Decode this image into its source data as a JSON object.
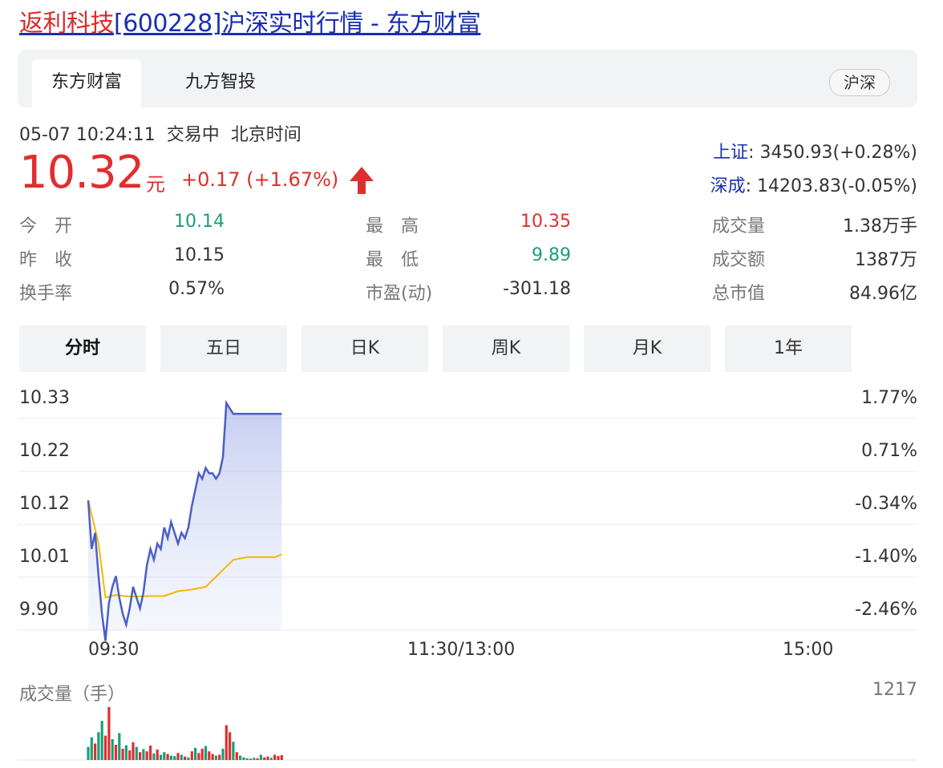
{
  "page_title": {
    "stock_name": "返利科技",
    "code": "[600228]",
    "suffix": "沪深实时行情 - 东方财富"
  },
  "tabs": [
    {
      "label": "东方财富",
      "active": true
    },
    {
      "label": "九方智投",
      "active": false
    }
  ],
  "market_pill": "沪深",
  "status": {
    "datetime": "05-07 10:24:11",
    "state": "交易中",
    "tz": "北京时间"
  },
  "quote": {
    "price": "10.32",
    "currency": "元",
    "change": "+0.17 (+1.67%)"
  },
  "indices": [
    {
      "name": "上证",
      "value": ": 3450.93(+0.28%)"
    },
    {
      "name": "深成",
      "value": ": 14203.83(-0.05%)"
    }
  ],
  "stats": [
    {
      "label": "今　开",
      "value": "10.14",
      "color": "green"
    },
    {
      "label": "昨　收",
      "value": "10.15",
      "color": "normal"
    },
    {
      "label": "换手率",
      "value": "0.57%",
      "color": "normal"
    },
    {
      "label": "最　高",
      "value": "10.35",
      "color": "red"
    },
    {
      "label": "最　低",
      "value": "9.89",
      "color": "green"
    },
    {
      "label": "市盈(动)",
      "value": "-301.18",
      "color": "normal"
    },
    {
      "label": "成交量",
      "value": "1.38万手",
      "color": "normal"
    },
    {
      "label": "成交额",
      "value": "1387万",
      "color": "normal"
    },
    {
      "label": "总市值",
      "value": "84.96亿",
      "color": "normal"
    }
  ],
  "periods": [
    "分时",
    "五日",
    "日K",
    "周K",
    "月K",
    "1年"
  ],
  "active_period": "分时",
  "colors": {
    "up": "#e02e2e",
    "down": "#1a9e7a",
    "price_line": "#4a5fc7",
    "avg_line": "#f5b800",
    "link": "#1a2fb0"
  },
  "chart_data": {
    "type": "line",
    "y_left_ticks": [
      "10.33",
      "10.22",
      "10.12",
      "10.01",
      "9.90"
    ],
    "y_right_ticks": [
      "1.77%",
      "0.71%",
      "-0.34%",
      "-1.40%",
      "-2.46%"
    ],
    "x_ticks": [
      "09:30",
      "11:30/13:00",
      "15:00"
    ],
    "ylim": [
      9.9,
      10.33
    ],
    "session_minutes": 240,
    "series": [
      {
        "kind": "price",
        "x": [
          0,
          1,
          2,
          3,
          4,
          5,
          6,
          7,
          8,
          9,
          10,
          11,
          12,
          13,
          14,
          15,
          16,
          17,
          18,
          19,
          20,
          21,
          22,
          23,
          24,
          25,
          26,
          27,
          28,
          29,
          30,
          31,
          32,
          33,
          34,
          35,
          36,
          37,
          38,
          39,
          40,
          41,
          42,
          43,
          44,
          45,
          46,
          47,
          48,
          49,
          50,
          51,
          52,
          53,
          54,
          55,
          56
        ],
        "y": [
          10.14,
          10.05,
          10.08,
          10.0,
          9.93,
          9.88,
          9.95,
          9.98,
          10.0,
          9.96,
          9.93,
          9.91,
          9.94,
          9.98,
          9.96,
          9.94,
          9.97,
          10.02,
          10.05,
          10.03,
          10.06,
          10.05,
          10.09,
          10.07,
          10.1,
          10.08,
          10.06,
          10.08,
          10.07,
          10.09,
          10.13,
          10.16,
          10.19,
          10.18,
          10.2,
          10.19,
          10.19,
          10.18,
          10.19,
          10.22,
          10.32,
          10.31,
          10.3,
          10.3,
          10.3,
          10.3,
          10.3,
          10.3,
          10.3,
          10.3,
          10.3,
          10.3,
          10.3,
          10.3,
          10.3,
          10.3,
          10.3
        ]
      },
      {
        "kind": "average",
        "x": [
          0,
          3,
          5,
          8,
          12,
          18,
          22,
          26,
          30,
          34,
          38,
          42,
          46,
          50,
          54,
          56
        ],
        "y": [
          10.14,
          10.06,
          9.96,
          9.965,
          9.962,
          9.963,
          9.963,
          9.972,
          9.975,
          9.98,
          10.005,
          10.03,
          10.035,
          10.035,
          10.035,
          10.04
        ]
      }
    ],
    "volume": {
      "max_label": "1217",
      "bars": [
        {
          "v": 300,
          "up": false
        },
        {
          "v": 520,
          "up": false
        },
        {
          "v": 380,
          "up": true
        },
        {
          "v": 640,
          "up": false
        },
        {
          "v": 900,
          "up": false
        },
        {
          "v": 560,
          "up": true
        },
        {
          "v": 1217,
          "up": true
        },
        {
          "v": 480,
          "up": false
        },
        {
          "v": 350,
          "up": true
        },
        {
          "v": 620,
          "up": false
        },
        {
          "v": 260,
          "up": true
        },
        {
          "v": 340,
          "up": false
        },
        {
          "v": 220,
          "up": true
        },
        {
          "v": 410,
          "up": true
        },
        {
          "v": 300,
          "up": false
        },
        {
          "v": 180,
          "up": true
        },
        {
          "v": 250,
          "up": false
        },
        {
          "v": 200,
          "up": true
        },
        {
          "v": 330,
          "up": true
        },
        {
          "v": 150,
          "up": false
        },
        {
          "v": 240,
          "up": true
        },
        {
          "v": 120,
          "up": false
        },
        {
          "v": 180,
          "up": false
        },
        {
          "v": 140,
          "up": true
        },
        {
          "v": 100,
          "up": false
        },
        {
          "v": 90,
          "up": false
        },
        {
          "v": 160,
          "up": true
        },
        {
          "v": 120,
          "up": false
        },
        {
          "v": 80,
          "up": true
        },
        {
          "v": 60,
          "up": false
        },
        {
          "v": 200,
          "up": true
        },
        {
          "v": 280,
          "up": false
        },
        {
          "v": 160,
          "up": true
        },
        {
          "v": 260,
          "up": true
        },
        {
          "v": 320,
          "up": false
        },
        {
          "v": 200,
          "up": true
        },
        {
          "v": 140,
          "up": true
        },
        {
          "v": 100,
          "up": false
        },
        {
          "v": 120,
          "up": true
        },
        {
          "v": 260,
          "up": false
        },
        {
          "v": 800,
          "up": true
        },
        {
          "v": 640,
          "up": true
        },
        {
          "v": 420,
          "up": false
        },
        {
          "v": 180,
          "up": true
        },
        {
          "v": 100,
          "up": false
        },
        {
          "v": 60,
          "up": false
        },
        {
          "v": 40,
          "up": false
        },
        {
          "v": 30,
          "up": true
        },
        {
          "v": 50,
          "up": false
        },
        {
          "v": 40,
          "up": true
        },
        {
          "v": 120,
          "up": false
        },
        {
          "v": 60,
          "up": true
        },
        {
          "v": 80,
          "up": true
        },
        {
          "v": 50,
          "up": false
        },
        {
          "v": 120,
          "up": true
        },
        {
          "v": 90,
          "up": true
        },
        {
          "v": 110,
          "up": true
        }
      ]
    }
  }
}
